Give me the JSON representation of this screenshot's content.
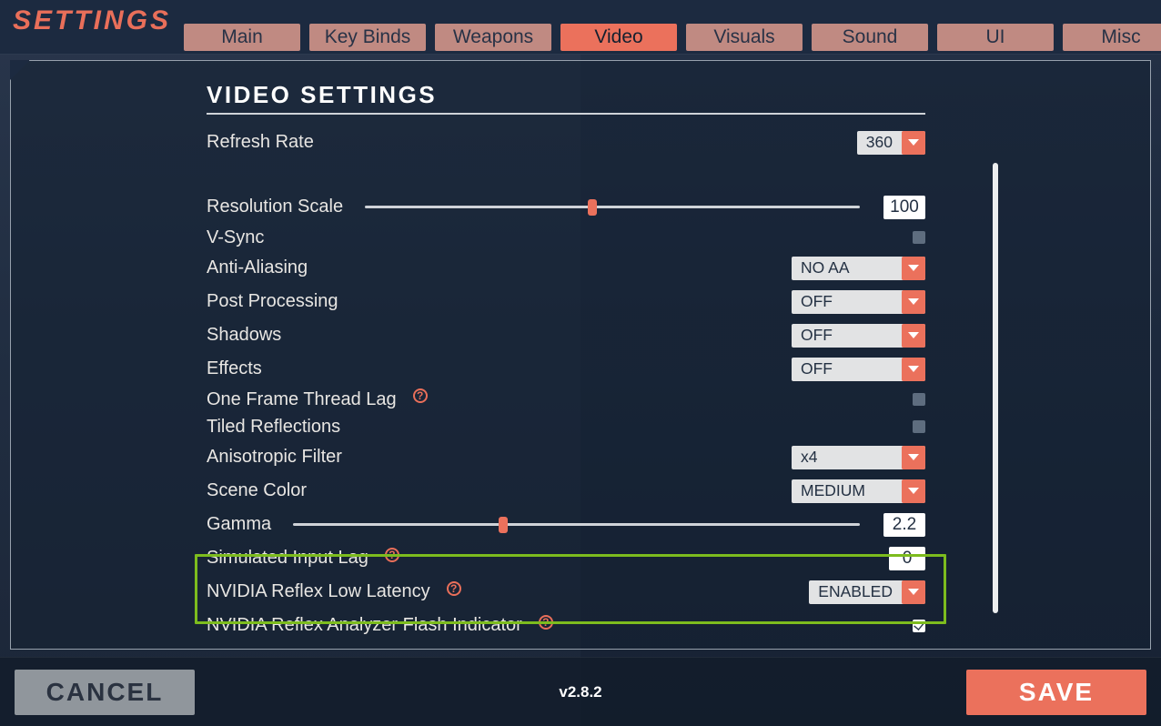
{
  "title": "SETTINGS",
  "tabs": [
    "Main",
    "Key Binds",
    "Weapons",
    "Video",
    "Visuals",
    "Sound",
    "UI",
    "Misc"
  ],
  "active_tab": "Video",
  "heading": "VIDEO SETTINGS",
  "rows": {
    "refresh_rate": {
      "label": "Refresh Rate",
      "value": "360"
    },
    "resolution_scale": {
      "label": "Resolution Scale",
      "value": "100",
      "slider_pct": 46
    },
    "vsync": {
      "label": "V-Sync",
      "checked": false
    },
    "anti_aliasing": {
      "label": "Anti-Aliasing",
      "value": "NO AA"
    },
    "post_processing": {
      "label": "Post Processing",
      "value": "OFF"
    },
    "shadows": {
      "label": "Shadows",
      "value": "OFF"
    },
    "effects": {
      "label": "Effects",
      "value": "OFF"
    },
    "one_frame_thread_lag": {
      "label": "One Frame Thread Lag",
      "checked": false,
      "help": true
    },
    "tiled_reflections": {
      "label": "Tiled Reflections",
      "checked": false
    },
    "anisotropic_filter": {
      "label": "Anisotropic Filter",
      "value": "x4"
    },
    "scene_color": {
      "label": "Scene Color",
      "value": "MEDIUM"
    },
    "gamma": {
      "label": "Gamma",
      "value": "2.2",
      "slider_pct": 37
    },
    "simulated_input_lag": {
      "label": "Simulated Input Lag",
      "value": "0",
      "help": true
    },
    "nvidia_reflex": {
      "label": "NVIDIA Reflex Low Latency",
      "value": "ENABLED",
      "help": true
    },
    "nvidia_analyzer": {
      "label": "NVIDIA Reflex Analyzer Flash Indicator",
      "checked": true,
      "help": true
    }
  },
  "footer": {
    "cancel": "CANCEL",
    "save": "SAVE",
    "version": "v2.8.2"
  },
  "colors": {
    "accent": "#eb715c",
    "highlight": "#7dbc1e"
  }
}
